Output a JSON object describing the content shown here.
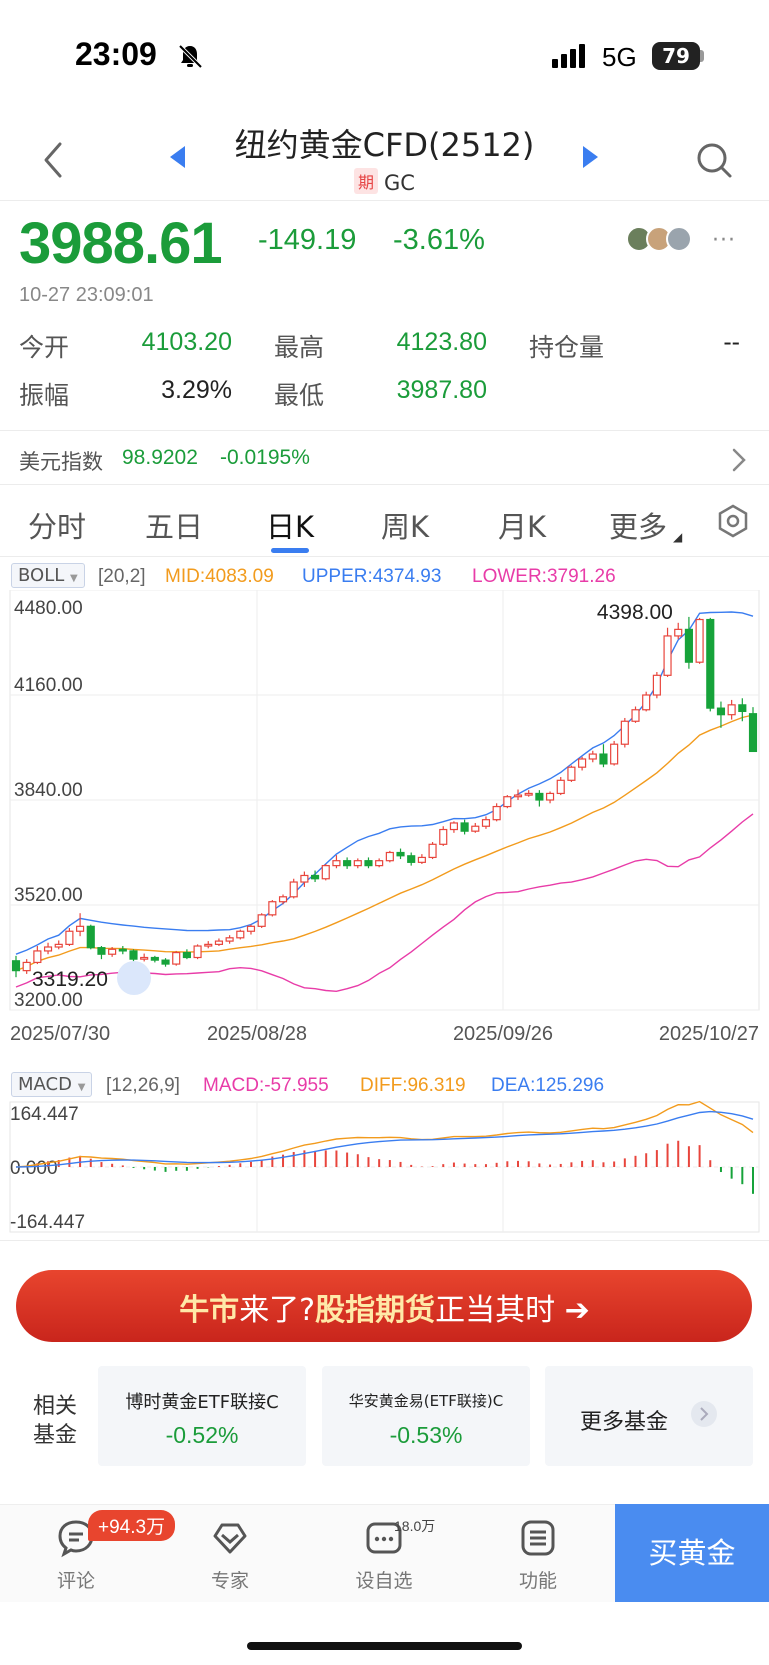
{
  "status_bar": {
    "time": "23:09",
    "network": "5G",
    "battery": "79"
  },
  "header": {
    "title": "纽约黄金CFD(2512)",
    "badge": "期",
    "code": "GC"
  },
  "quote": {
    "price": "3988.61",
    "change": "-149.19",
    "change_pct": "-3.61%",
    "timestamp": "10-27 23:09:01",
    "stats": [
      {
        "label": "今开",
        "value": "4103.20"
      },
      {
        "label": "最高",
        "value": "4123.80"
      },
      {
        "label": "持仓量",
        "value": "--"
      },
      {
        "label": "振幅",
        "value": "3.29%"
      },
      {
        "label": "最低",
        "value": "3987.80"
      }
    ]
  },
  "usd_index": {
    "label": "美元指数",
    "value": "98.9202",
    "change": "-0.0195%"
  },
  "tabs": [
    "分时",
    "五日",
    "日K",
    "周K",
    "月K",
    "更多"
  ],
  "active_tab": "日K",
  "boll": {
    "name": "BOLL",
    "params": "[20,2]",
    "mid": "MID:4083.09",
    "upper": "UPPER:4374.93",
    "lower": "LOWER:3791.26"
  },
  "macd": {
    "name": "MACD",
    "params": "[12,26,9]",
    "macd": "MACD:-57.955",
    "diff": "DIFF:96.319",
    "dea": "DEA:125.296"
  },
  "colors": {
    "up": "#e8453c",
    "down": "#16a33a",
    "upper": "#3a7df0",
    "mid": "#f29b1d",
    "lower": "#e83ca8"
  },
  "chart_data": [
    {
      "type": "candlestick",
      "y_ticks": [
        "4480.00",
        "4160.00",
        "3840.00",
        "3520.00",
        "3200.00"
      ],
      "ylim": [
        3200,
        4480
      ],
      "x_labels": [
        "2025/07/30",
        "2025/08/28",
        "2025/09/26",
        "2025/10/27"
      ],
      "high_label": "4398.00",
      "low_label": "3319.20",
      "candles": [
        [
          3350,
          3320,
          3365,
          3300
        ],
        [
          3320,
          3345,
          3355,
          3310
        ],
        [
          3345,
          3380,
          3395,
          3340
        ],
        [
          3380,
          3392,
          3405,
          3370
        ],
        [
          3392,
          3400,
          3412,
          3385
        ],
        [
          3400,
          3440,
          3450,
          3395
        ],
        [
          3440,
          3455,
          3495,
          3425
        ],
        [
          3455,
          3390,
          3460,
          3385
        ],
        [
          3390,
          3370,
          3395,
          3355
        ],
        [
          3370,
          3385,
          3392,
          3362
        ],
        [
          3385,
          3380,
          3395,
          3370
        ],
        [
          3380,
          3355,
          3385,
          3348
        ],
        [
          3355,
          3360,
          3372,
          3348
        ],
        [
          3360,
          3352,
          3365,
          3345
        ],
        [
          3352,
          3340,
          3358,
          3332
        ],
        [
          3340,
          3375,
          3380,
          3335
        ],
        [
          3375,
          3360,
          3385,
          3355
        ],
        [
          3360,
          3395,
          3400,
          3355
        ],
        [
          3395,
          3400,
          3410,
          3388
        ],
        [
          3400,
          3410,
          3418,
          3395
        ],
        [
          3410,
          3420,
          3428,
          3402
        ],
        [
          3420,
          3440,
          3445,
          3415
        ],
        [
          3440,
          3455,
          3460,
          3430
        ],
        [
          3455,
          3490,
          3495,
          3450
        ],
        [
          3490,
          3530,
          3535,
          3485
        ],
        [
          3530,
          3545,
          3552,
          3522
        ],
        [
          3545,
          3590,
          3600,
          3540
        ],
        [
          3590,
          3610,
          3622,
          3575
        ],
        [
          3610,
          3600,
          3625,
          3590
        ],
        [
          3600,
          3640,
          3645,
          3595
        ],
        [
          3640,
          3655,
          3672,
          3632
        ],
        [
          3655,
          3640,
          3665,
          3630
        ],
        [
          3640,
          3655,
          3662,
          3632
        ],
        [
          3655,
          3640,
          3665,
          3632
        ],
        [
          3640,
          3655,
          3662,
          3635
        ],
        [
          3655,
          3680,
          3685,
          3650
        ],
        [
          3680,
          3670,
          3692,
          3660
        ],
        [
          3670,
          3650,
          3680,
          3640
        ],
        [
          3650,
          3665,
          3675,
          3645
        ],
        [
          3665,
          3705,
          3712,
          3660
        ],
        [
          3705,
          3750,
          3760,
          3700
        ],
        [
          3750,
          3770,
          3775,
          3740
        ],
        [
          3770,
          3745,
          3780,
          3735
        ],
        [
          3745,
          3760,
          3770,
          3740
        ],
        [
          3760,
          3780,
          3790,
          3752
        ],
        [
          3780,
          3820,
          3830,
          3775
        ],
        [
          3820,
          3850,
          3855,
          3815
        ],
        [
          3850,
          3855,
          3872,
          3840
        ],
        [
          3855,
          3860,
          3870,
          3850
        ],
        [
          3860,
          3840,
          3870,
          3820
        ],
        [
          3840,
          3860,
          3866,
          3830
        ],
        [
          3860,
          3900,
          3910,
          3855
        ],
        [
          3900,
          3940,
          3945,
          3895
        ],
        [
          3940,
          3965,
          3972,
          3930
        ],
        [
          3965,
          3980,
          3990,
          3955
        ],
        [
          3980,
          3950,
          4010,
          3940
        ],
        [
          3950,
          4010,
          4020,
          3945
        ],
        [
          4010,
          4080,
          4090,
          4000
        ],
        [
          4080,
          4115,
          4125,
          4075
        ],
        [
          4115,
          4160,
          4170,
          4110
        ],
        [
          4160,
          4220,
          4230,
          4150
        ],
        [
          4220,
          4340,
          4365,
          4215
        ],
        [
          4340,
          4360,
          4380,
          4330
        ],
        [
          4360,
          4260,
          4398,
          4240
        ],
        [
          4260,
          4390,
          4395,
          4255
        ],
        [
          4390,
          4120,
          4395,
          4110
        ],
        [
          4120,
          4100,
          4140,
          4060
        ],
        [
          4100,
          4130,
          4145,
          4085
        ],
        [
          4130,
          4110,
          4150,
          4080
        ],
        [
          4103,
          3988,
          4123,
          3987
        ]
      ]
    },
    {
      "type": "bar",
      "name": "MACD",
      "y_ticks": [
        "164.447",
        "0.000",
        "-164.447"
      ],
      "ylim": [
        -164.447,
        164.447
      ]
    }
  ],
  "funds": {
    "label": "相关基金",
    "items": [
      {
        "name": "博时黄金ETF联接C",
        "change": "-0.52%"
      },
      {
        "name": "华安黄金易(ETF联接)C",
        "change": "-0.53%"
      }
    ],
    "more": "更多基金"
  },
  "banner": {
    "part1": "牛市",
    "part2": "来了?",
    "part3": "股指期货",
    "part4": "正当其时 ➔"
  },
  "bottom_nav": {
    "items": [
      {
        "label": "评论"
      },
      {
        "label": "专家"
      },
      {
        "label": "设自选"
      },
      {
        "label": "功能"
      }
    ],
    "comment_badge": "+94.3万",
    "watch_count": "18.0万",
    "buy": "买黄金"
  }
}
